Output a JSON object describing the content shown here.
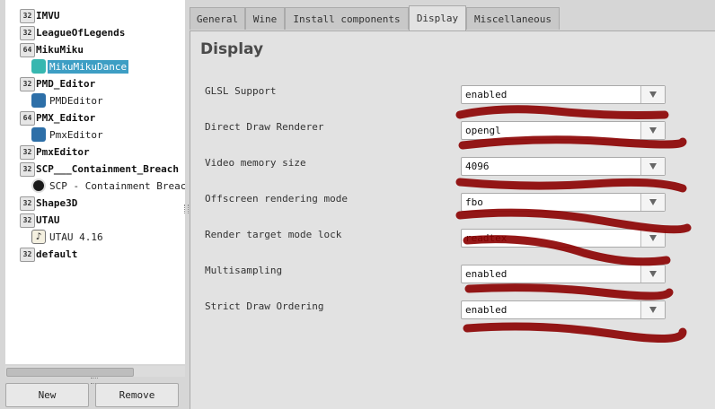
{
  "tree": {
    "items": [
      {
        "badge": "32",
        "label": "IMVU",
        "kind": "prefix"
      },
      {
        "badge": "32",
        "label": "LeagueOfLegends",
        "kind": "prefix"
      },
      {
        "badge": "64",
        "label": "MikuMiku",
        "kind": "prefix"
      },
      {
        "icon": "miku-character-icon",
        "label": "MikuMikuDance",
        "kind": "app",
        "selected": true
      },
      {
        "badge": "32",
        "label": "PMD_Editor",
        "kind": "prefix"
      },
      {
        "icon": "pmd-editor-icon",
        "label": "PMDEditor",
        "kind": "app"
      },
      {
        "badge": "64",
        "label": "PMX_Editor",
        "kind": "prefix"
      },
      {
        "icon": "pmx-editor-icon",
        "label": "PmxEditor",
        "kind": "app"
      },
      {
        "badge": "32",
        "label": "PmxEditor",
        "kind": "prefix"
      },
      {
        "badge": "32",
        "label": "SCP___Containment_Breach",
        "kind": "prefix"
      },
      {
        "icon": "scp-logo-icon",
        "label": "SCP - Containment Breach",
        "kind": "app"
      },
      {
        "badge": "32",
        "label": "Shape3D",
        "kind": "prefix"
      },
      {
        "badge": "32",
        "label": "UTAU",
        "kind": "prefix"
      },
      {
        "icon": "utau-music-note-icon",
        "label": "UTAU 4.16",
        "kind": "app"
      },
      {
        "badge": "32",
        "label": "default",
        "kind": "prefix"
      }
    ]
  },
  "buttons": {
    "new": "New",
    "remove": "Remove"
  },
  "tabs": [
    "General",
    "Wine",
    "Install components",
    "Display",
    "Miscellaneous"
  ],
  "active_tab": "Display",
  "display": {
    "title": "Display",
    "settings": [
      {
        "label": "GLSL Support",
        "value": "enabled"
      },
      {
        "label": "Direct Draw Renderer",
        "value": "opengl"
      },
      {
        "label": "Video memory size",
        "value": "4096"
      },
      {
        "label": "Offscreen rendering mode",
        "value": "fbo"
      },
      {
        "label": "Render target mode lock",
        "value": "readtex"
      },
      {
        "label": "Multisampling",
        "value": "enabled"
      },
      {
        "label": "Strict Draw Ordering",
        "value": "enabled"
      }
    ]
  },
  "colors": {
    "selection": "#3d9ec4",
    "scribble": "#8b0000"
  }
}
